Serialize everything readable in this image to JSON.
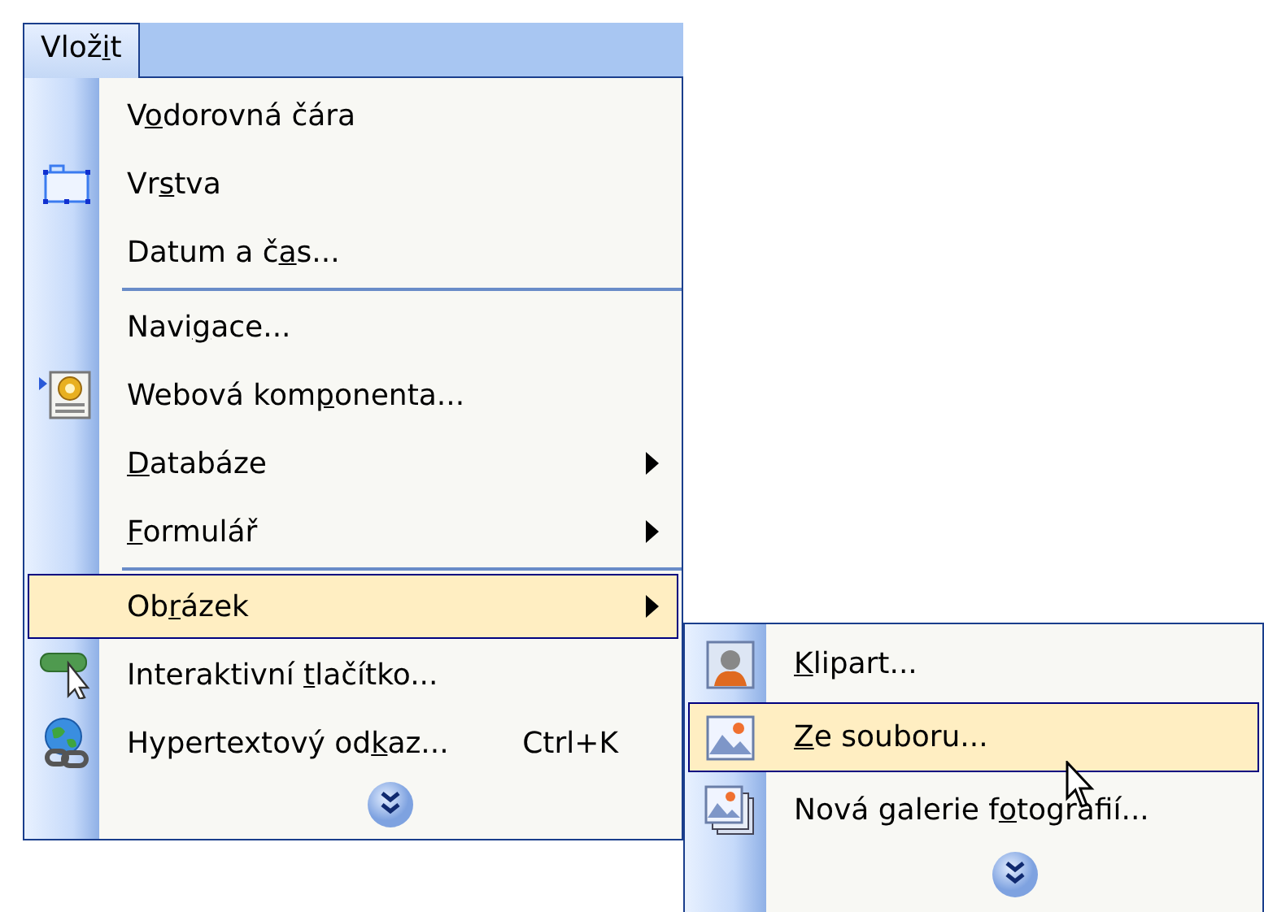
{
  "menu_bar": {
    "menus": [
      {
        "label": {
          "pre": "Vlož",
          "key": "i",
          "post": "t"
        },
        "selected": true
      }
    ]
  },
  "menu": {
    "items": [
      {
        "kind": "item",
        "label": {
          "pre": "V",
          "key": "o",
          "post": "dorovná čára"
        },
        "selected": false
      },
      {
        "kind": "item",
        "label": {
          "pre": "Vr",
          "key": "s",
          "post": "tva"
        },
        "selected": false
      },
      {
        "kind": "item",
        "label": {
          "pre": "Datum a č",
          "key": "a",
          "post": "s..."
        },
        "selected": false
      },
      {
        "kind": "separator"
      },
      {
        "kind": "item",
        "label": {
          "pre": "Navi",
          "key": "g",
          "post": "ace..."
        },
        "selected": false
      },
      {
        "kind": "item",
        "label": {
          "pre": "Webová kom",
          "key": "p",
          "post": "onenta..."
        },
        "selected": false
      },
      {
        "kind": "item",
        "label": {
          "key": "D",
          "post": "atabáze"
        },
        "submenu": true,
        "selected": false
      },
      {
        "kind": "item",
        "label": {
          "key": "F",
          "post": "ormulář"
        },
        "submenu": true,
        "selected": false
      },
      {
        "kind": "separator"
      },
      {
        "kind": "item",
        "label": {
          "pre": "Ob",
          "key": "r",
          "post": "ázek"
        },
        "submenu": true,
        "selected": true
      },
      {
        "kind": "item",
        "label": {
          "pre": "Interaktivní ",
          "key": "t",
          "post": "lačítko..."
        },
        "selected": false
      },
      {
        "kind": "item",
        "label": {
          "pre": "Hypertextový od",
          "key": "k",
          "post": "az..."
        },
        "shortcut": "Ctrl+K",
        "selected": false
      },
      {
        "kind": "more"
      }
    ]
  },
  "submenu": {
    "items": [
      {
        "kind": "item",
        "label": {
          "key": "K",
          "post": "lipart..."
        },
        "selected": false
      },
      {
        "kind": "item",
        "label": {
          "key": "Z",
          "post": "e souboru..."
        },
        "selected": true
      },
      {
        "kind": "item",
        "label": {
          "pre": "Nová galerie f",
          "key": "o",
          "post": "tografií..."
        },
        "selected": false
      },
      {
        "kind": "more"
      }
    ]
  }
}
